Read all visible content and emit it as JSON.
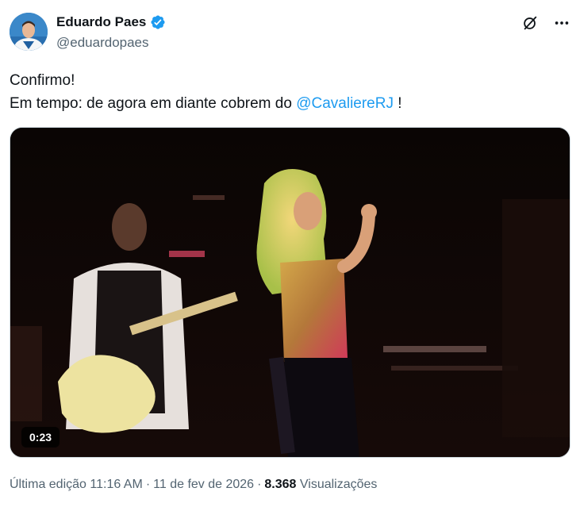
{
  "author": {
    "name": "Eduardo Paes",
    "handle": "@eduardopaes",
    "verified": true,
    "verified_icon": "verified-badge-icon"
  },
  "header_icons": [
    "grok-icon",
    "more-options-icon"
  ],
  "tweet": {
    "line1": "Confirmo!",
    "line2_prefix": "Em tempo: de agora em diante cobrem do ",
    "mention": "@CavaliereRJ",
    "line2_suffix": " !"
  },
  "media": {
    "type": "video",
    "duration": "0:23"
  },
  "meta": {
    "edited_label": "Última edição",
    "time": "11:16 AM",
    "date": "11 de fev de 2026",
    "views_count": "8.368",
    "views_label": "Visualizações"
  },
  "colors": {
    "accent": "#1d9bf0",
    "text": "#0f1419",
    "secondary": "#536471"
  }
}
